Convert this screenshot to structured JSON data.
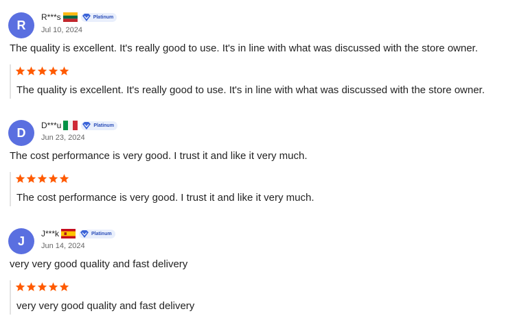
{
  "reviews": [
    {
      "initial": "R",
      "name": "R***s",
      "country_flag": "flag-lithuania",
      "badge": "Platinum",
      "date": "Jul 10, 2024",
      "text": "The quality is excellent. It's really good to use. It's in line with what was discussed with the store owner.",
      "rating": 5,
      "review_text": "The quality is excellent. It's really good to use. It's in line with what was discussed with the store owner."
    },
    {
      "initial": "D",
      "name": "D***u",
      "country_flag": "flag-italy",
      "badge": "Platinum",
      "date": "Jun 23, 2024",
      "text": "The cost performance is very good. I trust it and like it very much.",
      "rating": 5,
      "review_text": "The cost performance is very good. I trust it and like it very much."
    },
    {
      "initial": "J",
      "name": "J***k",
      "country_flag": "flag-spain",
      "badge": "Platinum",
      "date": "Jun 14, 2024",
      "text": "very very good quality and fast delivery",
      "rating": 5,
      "review_text": "very very good quality and fast delivery"
    }
  ],
  "colors": {
    "avatar": "#5a6fe0",
    "star": "#ff5a00",
    "badge_bg": "#e9effc",
    "badge_text": "#2a4db8"
  }
}
